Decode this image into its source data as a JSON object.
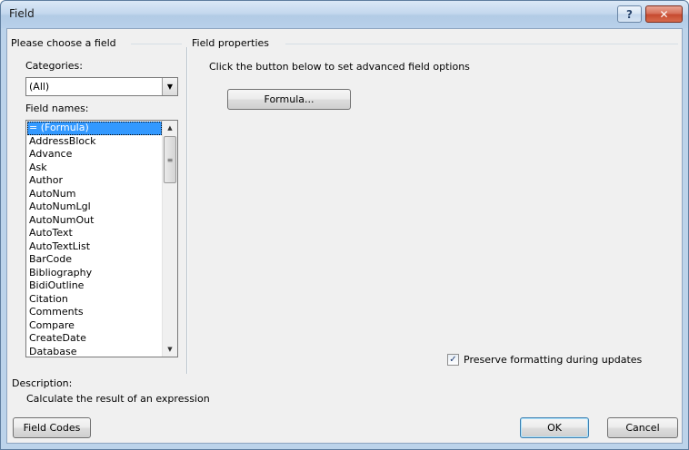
{
  "window": {
    "title": "Field",
    "help_label": "?",
    "close_label": "✕"
  },
  "left": {
    "group_title": "Please choose a field",
    "categories_label": "Categories:",
    "categories_value": "(All)",
    "field_names_label": "Field names:",
    "field_names": [
      "= (Formula)",
      "AddressBlock",
      "Advance",
      "Ask",
      "Author",
      "AutoNum",
      "AutoNumLgl",
      "AutoNumOut",
      "AutoText",
      "AutoTextList",
      "BarCode",
      "Bibliography",
      "BidiOutline",
      "Citation",
      "Comments",
      "Compare",
      "CreateDate",
      "Database"
    ],
    "selected_index": 0
  },
  "right": {
    "group_title": "Field properties",
    "instruction": "Click the button below to set advanced field options",
    "formula_button": "Formula...",
    "preserve_label": "Preserve formatting during updates",
    "preserve_checked": true
  },
  "description": {
    "label": "Description:",
    "text": "Calculate the result of an expression"
  },
  "buttons": {
    "field_codes": "Field Codes",
    "ok": "OK",
    "cancel": "Cancel"
  },
  "icons": {
    "dropdown_arrow": "▼",
    "scroll_up": "▲",
    "scroll_down": "▼",
    "scroll_grip": "≡",
    "check": "✓"
  }
}
